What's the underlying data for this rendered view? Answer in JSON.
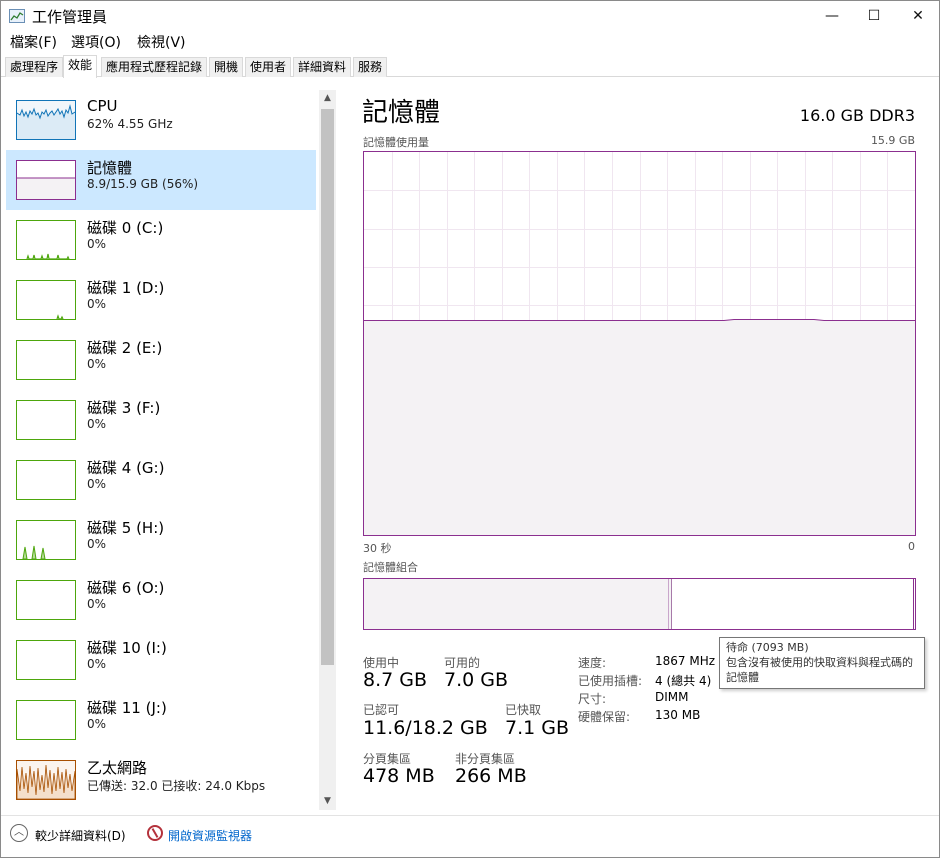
{
  "window": {
    "title": "工作管理員",
    "minimize": "—",
    "maximize": "☐",
    "close": "✕"
  },
  "menu": [
    "檔案(F)",
    "選項(O)",
    "檢視(V)"
  ],
  "tabs": [
    {
      "label": "處理程序",
      "active": false
    },
    {
      "label": "效能",
      "active": true
    },
    {
      "label": "應用程式歷程記錄",
      "active": false
    },
    {
      "label": "開機",
      "active": false
    },
    {
      "label": "使用者",
      "active": false
    },
    {
      "label": "詳細資料",
      "active": false
    },
    {
      "label": "服務",
      "active": false
    }
  ],
  "sidebar": {
    "items": [
      {
        "title": "CPU",
        "sub": "62%  4.55 GHz",
        "color": "#1174b7",
        "selected": false
      },
      {
        "title": "記憶體",
        "sub": "8.9/15.9 GB (56%)",
        "color": "#8b2f8f",
        "selected": true
      },
      {
        "title": "磁碟 0 (C:)",
        "sub": "0%",
        "color": "#4da60c",
        "selected": false
      },
      {
        "title": "磁碟 1 (D:)",
        "sub": "0%",
        "color": "#4da60c",
        "selected": false
      },
      {
        "title": "磁碟 2 (E:)",
        "sub": "0%",
        "color": "#4da60c",
        "selected": false
      },
      {
        "title": "磁碟 3 (F:)",
        "sub": "0%",
        "color": "#4da60c",
        "selected": false
      },
      {
        "title": "磁碟 4 (G:)",
        "sub": "0%",
        "color": "#4da60c",
        "selected": false
      },
      {
        "title": "磁碟 5 (H:)",
        "sub": "0%",
        "color": "#4da60c",
        "selected": false
      },
      {
        "title": "磁碟 6 (O:)",
        "sub": "0%",
        "color": "#4da60c",
        "selected": false
      },
      {
        "title": "磁碟 10 (I:)",
        "sub": "0%",
        "color": "#4da60c",
        "selected": false
      },
      {
        "title": "磁碟 11 (J:)",
        "sub": "0%",
        "color": "#4da60c",
        "selected": false
      },
      {
        "title": "乙太網路",
        "sub": "已傳送: 32.0 已接收: 24.0 Kbps",
        "color": "#a74f01",
        "selected": false
      }
    ]
  },
  "main": {
    "title": "記憶體",
    "spec": "16.0 GB DDR3",
    "usage_label": "記憶體使用量",
    "usage_max": "15.9 GB",
    "time_left": "30 秒",
    "time_right": "0",
    "composition_label": "記憶體組合",
    "usage_percent": 56,
    "stats": {
      "in_use_label": "使用中",
      "in_use": "8.7 GB",
      "available_label": "可用的",
      "available": "7.0 GB",
      "committed_label": "已認可",
      "committed": "11.6/18.2 GB",
      "cached_label": "已快取",
      "cached": "7.1 GB",
      "paged_label": "分頁集區",
      "paged": "478 MB",
      "nonpaged_label": "非分頁集區",
      "nonpaged": "266 MB"
    },
    "specs": {
      "speed_label": "速度:",
      "speed": "1867 MHz",
      "slots_label": "已使用插槽:",
      "slots": "4 (總共 4)",
      "form_label": "尺寸:",
      "form": "DIMM",
      "reserved_label": "硬體保留:",
      "reserved": "130 MB"
    },
    "tooltip": {
      "title": "待命 (7093 MB)",
      "body": "包含沒有被使用的快取資料與程式碼的記憶體"
    }
  },
  "footer": {
    "fewer_details": "較少詳細資料(D)",
    "open_monitor": "開啟資源監視器"
  }
}
